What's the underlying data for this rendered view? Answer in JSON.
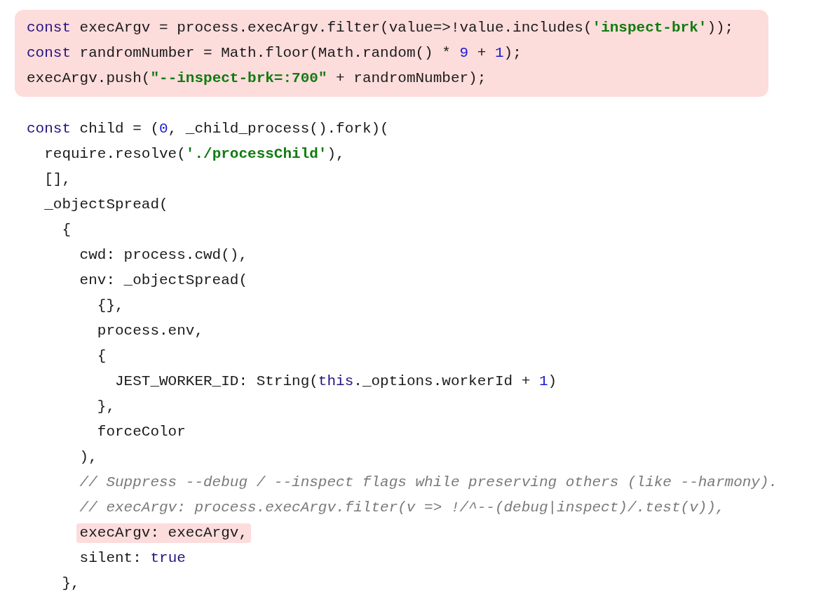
{
  "blocks": [
    {
      "highlighted": true,
      "lines": [
        {
          "tokens": [
            {
              "kind": "keyword",
              "text": "const"
            },
            {
              "kind": "plain",
              "text": " execArgv = process.execArgv.filter(value=>!value.includes("
            },
            {
              "kind": "string",
              "text": "'inspect-brk'"
            },
            {
              "kind": "plain",
              "text": "));"
            }
          ]
        },
        {
          "tokens": [
            {
              "kind": "keyword",
              "text": "const"
            },
            {
              "kind": "plain",
              "text": " randromNumber = Math.floor(Math.random() * "
            },
            {
              "kind": "number",
              "text": "9"
            },
            {
              "kind": "plain",
              "text": " + "
            },
            {
              "kind": "number",
              "text": "1"
            },
            {
              "kind": "plain",
              "text": ");"
            }
          ]
        },
        {
          "tokens": [
            {
              "kind": "plain",
              "text": "execArgv.push("
            },
            {
              "kind": "string",
              "text": "\"--inspect-brk=:700\""
            },
            {
              "kind": "plain",
              "text": " + randromNumber);"
            }
          ]
        }
      ]
    },
    {
      "highlighted": false,
      "lines": [
        {
          "highlighted": false,
          "tokens": [
            {
              "kind": "keyword",
              "text": "const"
            },
            {
              "kind": "plain",
              "text": " child = ("
            },
            {
              "kind": "number",
              "text": "0"
            },
            {
              "kind": "plain",
              "text": ", _child_process().fork)("
            }
          ]
        },
        {
          "highlighted": false,
          "tokens": [
            {
              "kind": "plain",
              "text": "  require.resolve("
            },
            {
              "kind": "string",
              "text": "'./processChild'"
            },
            {
              "kind": "plain",
              "text": "),"
            }
          ]
        },
        {
          "highlighted": false,
          "tokens": [
            {
              "kind": "plain",
              "text": "  [],"
            }
          ]
        },
        {
          "highlighted": false,
          "tokens": [
            {
              "kind": "plain",
              "text": "  _objectSpread("
            }
          ]
        },
        {
          "highlighted": false,
          "tokens": [
            {
              "kind": "plain",
              "text": "    {"
            }
          ]
        },
        {
          "highlighted": false,
          "tokens": [
            {
              "kind": "plain",
              "text": "      cwd: process.cwd(),"
            }
          ]
        },
        {
          "highlighted": false,
          "tokens": [
            {
              "kind": "plain",
              "text": "      env: _objectSpread("
            }
          ]
        },
        {
          "highlighted": false,
          "tokens": [
            {
              "kind": "plain",
              "text": "        {},"
            }
          ]
        },
        {
          "highlighted": false,
          "tokens": [
            {
              "kind": "plain",
              "text": "        process.env,"
            }
          ]
        },
        {
          "highlighted": false,
          "tokens": [
            {
              "kind": "plain",
              "text": "        {"
            }
          ]
        },
        {
          "highlighted": false,
          "tokens": [
            {
              "kind": "plain",
              "text": "          JEST_WORKER_ID: String("
            },
            {
              "kind": "keyword",
              "text": "this"
            },
            {
              "kind": "plain",
              "text": "._options.workerId + "
            },
            {
              "kind": "number",
              "text": "1"
            },
            {
              "kind": "plain",
              "text": ")"
            }
          ]
        },
        {
          "highlighted": false,
          "tokens": [
            {
              "kind": "plain",
              "text": "        },"
            }
          ]
        },
        {
          "highlighted": false,
          "tokens": [
            {
              "kind": "plain",
              "text": "        forceColor"
            }
          ]
        },
        {
          "highlighted": false,
          "tokens": [
            {
              "kind": "plain",
              "text": "      ),"
            }
          ]
        },
        {
          "highlighted": false,
          "tokens": [
            {
              "kind": "comment",
              "text": "      // Suppress --debug / --inspect flags while preserving others (like --harmony)."
            }
          ]
        },
        {
          "highlighted": false,
          "tokens": [
            {
              "kind": "comment",
              "text": "      // execArgv: process.execArgv.filter(v => !/^--(debug|inspect)/.test(v)),"
            }
          ]
        },
        {
          "highlighted": true,
          "tokens": [
            {
              "kind": "plain",
              "text": "      execArgv: execArgv,"
            }
          ]
        },
        {
          "highlighted": false,
          "tokens": [
            {
              "kind": "plain",
              "text": "      silent: "
            },
            {
              "kind": "keyword",
              "text": "true"
            }
          ]
        },
        {
          "highlighted": false,
          "tokens": [
            {
              "kind": "plain",
              "text": "    },"
            }
          ]
        }
      ]
    }
  ]
}
